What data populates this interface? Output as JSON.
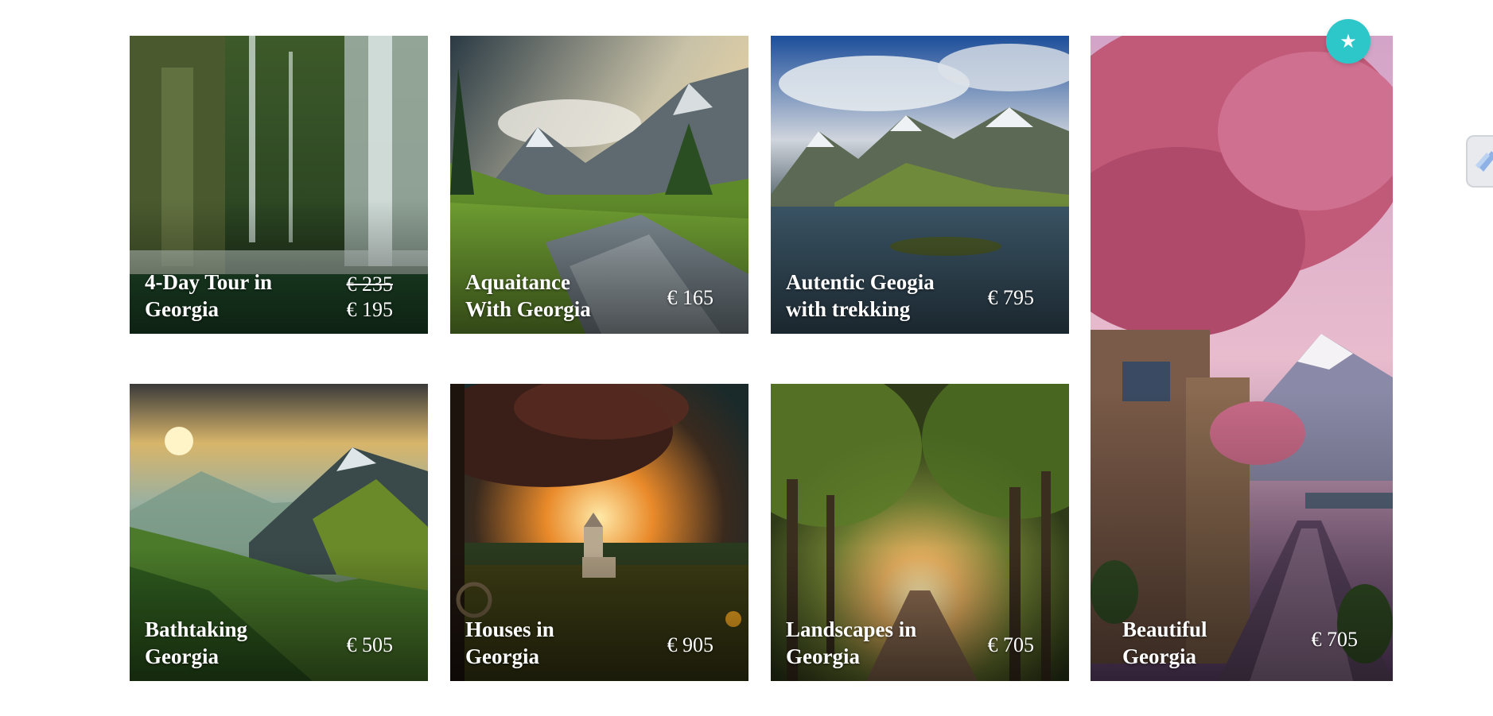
{
  "tours": [
    {
      "title": "4-Day Tour in\nGeorgia",
      "old_price": "€ 235",
      "price": "€ 195"
    },
    {
      "title": "Aquaitance\nWith Georgia",
      "price": "€ 165"
    },
    {
      "title": "Autentic Geogia\nwith trekking",
      "price": "€ 795"
    },
    {
      "title": "Beautiful\nGeorgia",
      "price": "€ 705"
    },
    {
      "title": "Bathtaking\nGeorgia",
      "price": "€ 505"
    },
    {
      "title": "Houses in\nGeorgia",
      "price": "€ 905"
    },
    {
      "title": "Landscapes in\nGeorgia",
      "price": "€ 705"
    }
  ],
  "favorite_button": {
    "icon": "star-icon",
    "color": "#2ec7c9"
  },
  "side_tab": {
    "icon": "pencil-icon"
  }
}
